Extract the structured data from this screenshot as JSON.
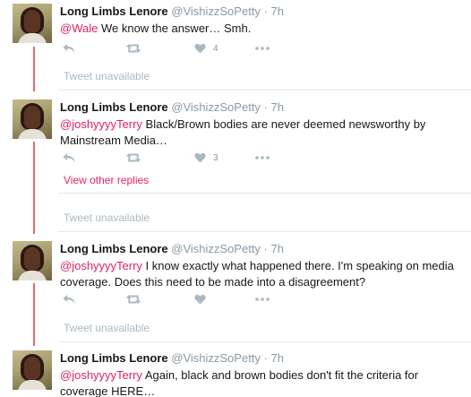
{
  "tweets": [
    {
      "name": "Long Limbs Lenore",
      "handle": "@VishizzSoPetty",
      "dot": "·",
      "time": "7h",
      "mention": "@Wale",
      "text": " We know the answer… Smh.",
      "likes": "4"
    },
    {
      "name": "Long Limbs Lenore",
      "handle": "@VishizzSoPetty",
      "dot": "·",
      "time": "7h",
      "mention": "@joshyyyyTerry",
      "text": " Black/Brown bodies are never deemed newsworthy by Mainstream Media…",
      "likes": "3"
    },
    {
      "name": "Long Limbs Lenore",
      "handle": "@VishizzSoPetty",
      "dot": "·",
      "time": "7h",
      "mention": "@joshyyyyTerry",
      "text": " I know exactly what happened there. I'm speaking on media coverage. Does this need to be made into a disagreement?",
      "likes": ""
    },
    {
      "name": "Long Limbs Lenore",
      "handle": "@VishizzSoPetty",
      "dot": "·",
      "time": "7h",
      "mention": "@joshyyyyTerry",
      "text": " Again, black and brown bodies don't fit the criteria for coverage HERE…",
      "likes": ""
    }
  ],
  "unavailable_label": "Tweet unavailable",
  "view_other_replies": "View other replies",
  "icons": {
    "reply": "reply-icon",
    "retweet": "retweet-icon",
    "like": "heart-icon",
    "more": "more-icon"
  },
  "colors": {
    "thread_line": "#e26b6b",
    "mention": "#e0245e",
    "muted": "#8899a6",
    "icon": "#aab8c2"
  }
}
